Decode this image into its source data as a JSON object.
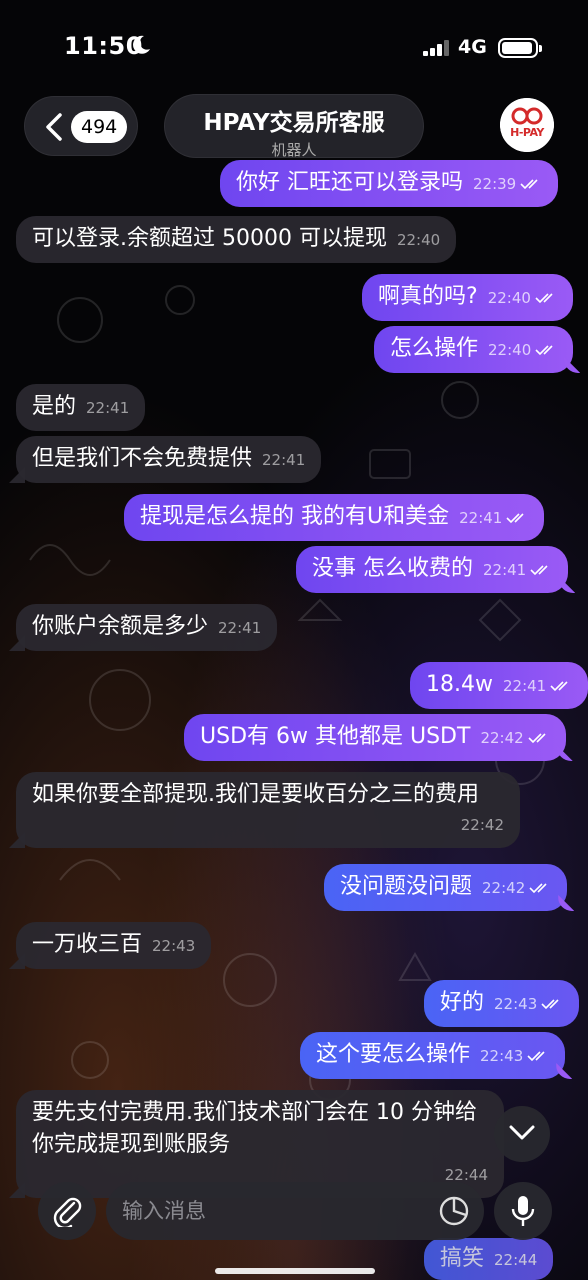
{
  "status_bar": {
    "time": "11:50",
    "network": "4G"
  },
  "header": {
    "unread_count": "494",
    "title": "HPAY交易所客服",
    "subtitle": "机器人",
    "avatar_logo_text": "H-PAY"
  },
  "messages": [
    {
      "dir": "out",
      "text": "你好 汇旺还可以登录吗",
      "time": "22:39"
    },
    {
      "dir": "in",
      "text": "可以登录.余额超过 50000 可以提现",
      "time": "22:40"
    },
    {
      "dir": "out",
      "text": "啊真的吗?",
      "time": "22:40"
    },
    {
      "dir": "out",
      "text": "怎么操作",
      "time": "22:40"
    },
    {
      "dir": "in",
      "text": "是的",
      "time": "22:41"
    },
    {
      "dir": "in",
      "text": "但是我们不会免费提供",
      "time": "22:41"
    },
    {
      "dir": "out",
      "text": "提现是怎么提的 我的有U和美金",
      "time": "22:41"
    },
    {
      "dir": "out",
      "text": "没事 怎么收费的",
      "time": "22:41"
    },
    {
      "dir": "in",
      "text": "你账户余额是多少",
      "time": "22:41"
    },
    {
      "dir": "out",
      "text": "18.4w",
      "time": "22:41"
    },
    {
      "dir": "out",
      "text": "USD有 6w 其他都是 USDT",
      "time": "22:42"
    },
    {
      "dir": "in",
      "text": "如果你要全部提现.我们是要收百分之三的费用",
      "time": "22:42"
    },
    {
      "dir": "out",
      "text": "没问题没问题",
      "time": "22:42"
    },
    {
      "dir": "in",
      "text": "一万收三百",
      "time": "22:43"
    },
    {
      "dir": "out",
      "text": "好的",
      "time": "22:43"
    },
    {
      "dir": "out",
      "text": "这个要怎么操作",
      "time": "22:43"
    },
    {
      "dir": "in",
      "text": "要先支付完费用.我们技术部门会在 10 分钟给你完成提现到账服务",
      "time": "22:44"
    }
  ],
  "composer": {
    "placeholder": "输入消息"
  },
  "peek_message": {
    "text": "搞笑",
    "time": "22:44"
  },
  "colors": {
    "outgoing_start": "#6f46f0",
    "outgoing_end": "#9a5af5",
    "incoming": "#2a2830",
    "background": "#050507"
  }
}
